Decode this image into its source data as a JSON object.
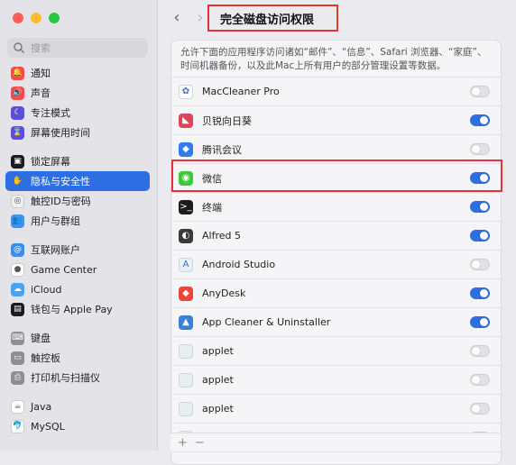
{
  "window": {
    "title": "完全磁盘访问权限"
  },
  "search": {
    "placeholder": "搜索"
  },
  "sidebar": {
    "items": [
      {
        "label": "通知",
        "icon": "bell-icon",
        "color": "#f24b4b",
        "glyph": "🔔"
      },
      {
        "label": "声音",
        "icon": "speaker-icon",
        "color": "#f24b4b",
        "glyph": "🔊"
      },
      {
        "label": "专注模式",
        "icon": "moon-icon",
        "color": "#5b4fd6",
        "glyph": "☾"
      },
      {
        "label": "屏幕使用时间",
        "icon": "hourglass-icon",
        "color": "#5b4fd6",
        "glyph": "⌛"
      },
      {
        "label": "锁定屏幕",
        "icon": "lock-screen-icon",
        "color": "#1c1c1e",
        "glyph": "▣"
      },
      {
        "label": "隐私与安全性",
        "icon": "hand-icon",
        "color": "#2e6ee3",
        "glyph": "✋",
        "selected": true
      },
      {
        "label": "触控ID与密码",
        "icon": "fingerprint-icon",
        "color": "#f0f0f0",
        "glyph": "◎"
      },
      {
        "label": "用户与群组",
        "icon": "users-icon",
        "color": "#4a90e2",
        "glyph": "👥"
      },
      {
        "label": "互联网账户",
        "icon": "at-icon",
        "color": "#3d8ce8",
        "glyph": "@"
      },
      {
        "label": "Game Center",
        "icon": "game-center-icon",
        "color": "#ffffff",
        "glyph": "●"
      },
      {
        "label": "iCloud",
        "icon": "cloud-icon",
        "color": "#4aa3f0",
        "glyph": "☁"
      },
      {
        "label": "钱包与 Apple Pay",
        "icon": "wallet-icon",
        "color": "#1c1c1e",
        "glyph": "▤"
      },
      {
        "label": "键盘",
        "icon": "keyboard-icon",
        "color": "#8e8e93",
        "glyph": "⌨"
      },
      {
        "label": "触控板",
        "icon": "trackpad-icon",
        "color": "#8e8e93",
        "glyph": "▭"
      },
      {
        "label": "打印机与扫描仪",
        "icon": "printer-icon",
        "color": "#8e8e93",
        "glyph": "⎙"
      },
      {
        "label": "Java",
        "icon": "java-icon",
        "color": "#ffffff",
        "glyph": "☕"
      },
      {
        "label": "MySQL",
        "icon": "mysql-icon",
        "color": "#ffffff",
        "glyph": "🐬"
      }
    ]
  },
  "main": {
    "description": "允许下面的应用程序访问诸如“邮件”、“信息”、Safari 浏览器、“家庭”、时间机器备份，以及此Mac上所有用户的部分管理设置等数据。",
    "apps": [
      {
        "name": "MacCleaner Pro",
        "icon": "maccleaner-icon",
        "color": "#ffffff",
        "glyph": "✿",
        "enabled": false
      },
      {
        "name": "贝锐向日葵",
        "icon": "sunflower-icon",
        "color": "#e0435a",
        "glyph": "◣",
        "enabled": true
      },
      {
        "name": "腾讯会议",
        "icon": "tencent-meeting-icon",
        "color": "#2f7cf6",
        "glyph": "◆",
        "enabled": false
      },
      {
        "name": "微信",
        "icon": "wechat-icon",
        "color": "#3dc83d",
        "glyph": "◉",
        "enabled": true,
        "highlighted": true
      },
      {
        "name": "终端",
        "icon": "terminal-icon",
        "color": "#1c1c1e",
        "glyph": ">_",
        "enabled": true
      },
      {
        "name": "Alfred 5",
        "icon": "alfred-icon",
        "color": "#3a3a3c",
        "glyph": "◐",
        "enabled": true
      },
      {
        "name": "Android Studio",
        "icon": "android-studio-icon",
        "color": "#e8f0f8",
        "glyph": "A",
        "enabled": false
      },
      {
        "name": "AnyDesk",
        "icon": "anydesk-icon",
        "color": "#ef443b",
        "glyph": "◆",
        "enabled": true
      },
      {
        "name": "App Cleaner & Uninstaller",
        "icon": "app-cleaner-icon",
        "color": "#3b7fd8",
        "glyph": "▲",
        "enabled": true
      },
      {
        "name": "applet",
        "icon": "applet-icon",
        "color": "#e9eef2",
        "glyph": "",
        "enabled": false
      },
      {
        "name": "applet",
        "icon": "applet-icon",
        "color": "#e9eef2",
        "glyph": "",
        "enabled": false
      },
      {
        "name": "applet",
        "icon": "applet-icon",
        "color": "#e9eef2",
        "glyph": "",
        "enabled": false
      },
      {
        "name": "",
        "icon": "applet-icon",
        "color": "#e9eef2",
        "glyph": "",
        "enabled": false
      }
    ],
    "add_label": "+",
    "remove_label": "−"
  }
}
